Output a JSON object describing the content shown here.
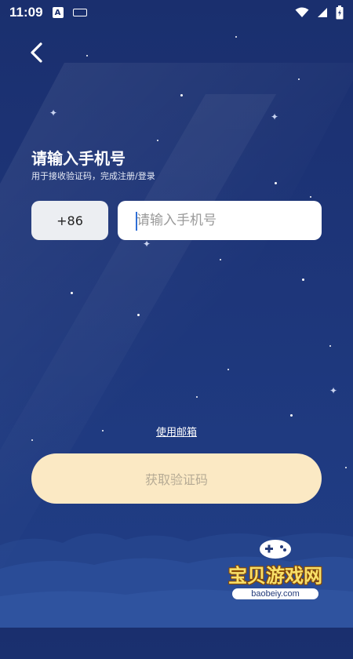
{
  "status_bar": {
    "time": "11:09",
    "left_icons": [
      "a-icon",
      "keyboard-icon"
    ],
    "right_icons": [
      "wifi-icon",
      "signal-icon",
      "battery-icon"
    ]
  },
  "header": {
    "back_icon": "chevron-left-icon"
  },
  "login": {
    "title": "请输入手机号",
    "subtitle": "用于接收验证码，完成注册/登录",
    "country_code": "+86",
    "phone_placeholder": "请输入手机号",
    "phone_value": "",
    "switch_email_label": "使用邮箱",
    "get_code_label": "获取验证码"
  },
  "watermark": {
    "title": "宝贝游戏网",
    "url": "baobeiy.com"
  },
  "colors": {
    "background": "#1d3477",
    "button_bg": "#fbe9c4",
    "button_text": "#b6ab95",
    "input_bg": "#ffffff",
    "country_bg": "#eceef2"
  }
}
